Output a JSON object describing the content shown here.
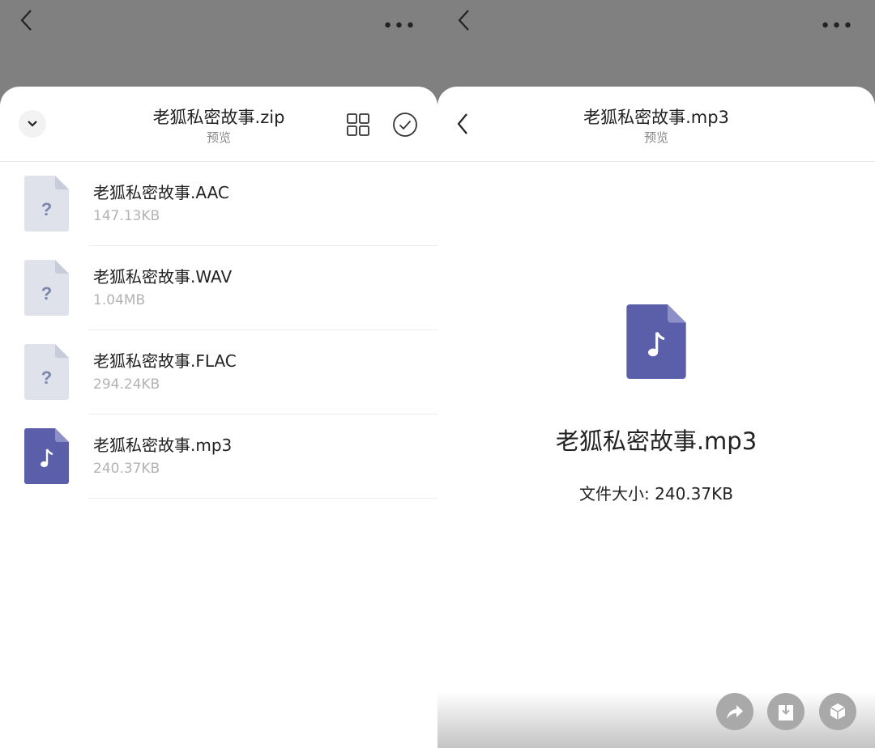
{
  "left": {
    "header": {
      "title": "老狐私密故事.zip",
      "subtitle": "预览"
    },
    "files": [
      {
        "name": "老狐私密故事.AAC",
        "size": "147.13KB",
        "icon": "unknown-file-icon"
      },
      {
        "name": "老狐私密故事.WAV",
        "size": "1.04MB",
        "icon": "unknown-file-icon"
      },
      {
        "name": "老狐私密故事.FLAC",
        "size": "294.24KB",
        "icon": "unknown-file-icon"
      },
      {
        "name": "老狐私密故事.mp3",
        "size": "240.37KB",
        "icon": "audio-file-icon"
      }
    ]
  },
  "right": {
    "header": {
      "title": "老狐私密故事.mp3",
      "subtitle": "预览"
    },
    "file_name": "老狐私密故事.mp3",
    "file_size": "文件大小: 240.37KB"
  },
  "more_label": "•••",
  "colors": {
    "audio": "#5b5ea8",
    "unknown": "#dfe2eb"
  }
}
